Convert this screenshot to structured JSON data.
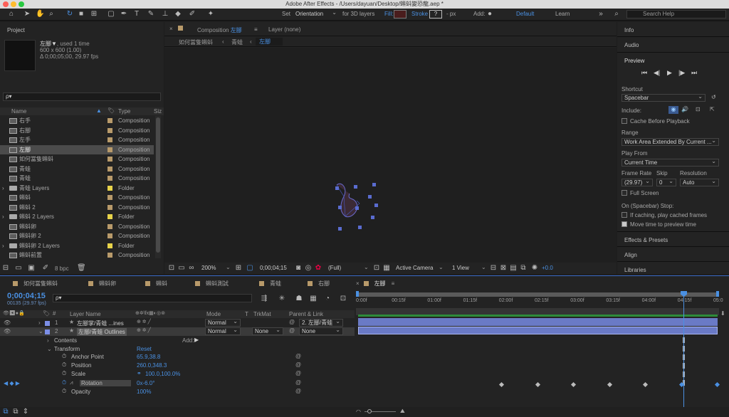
{
  "window": {
    "title": "Adobe After Effects - /Users/dayuan/Desktop/蝌蚪變恐龍.aep *"
  },
  "toolbar": {
    "set_label": "Set",
    "orientation_value": "Orientation",
    "for3d_label": "for 3D layers",
    "fill_label": "Fill:",
    "stroke_label": "Stroke",
    "stroke_value": "?",
    "px_label": "- px",
    "add_label": "Add:",
    "workspace_default": "Default",
    "workspace_learn": "Learn",
    "search_placeholder": "Search Help",
    "fill_color": "#4a1d1d"
  },
  "project": {
    "title": "Project",
    "item_name": "左腳▼",
    "item_used": ", used 1 time",
    "item_size": "600 x 600 (1.00)",
    "item_duration": "Δ 0;00;05;00, 29.97 fps",
    "search_placeholder": "ρ▾",
    "col_name": "Name",
    "col_type": "Type",
    "col_size": "Siz",
    "bpc": "8 bpc",
    "items": [
      {
        "name": "右手",
        "type": "Composition",
        "color": "#b89a6a",
        "kind": "comp"
      },
      {
        "name": "右腳",
        "type": "Composition",
        "color": "#b89a6a",
        "kind": "comp"
      },
      {
        "name": "左手",
        "type": "Composition",
        "color": "#b89a6a",
        "kind": "comp"
      },
      {
        "name": "左腳",
        "type": "Composition",
        "color": "#b89a6a",
        "kind": "comp",
        "selected": true
      },
      {
        "name": "如何當隻蝌蚪",
        "type": "Composition",
        "color": "#b89a6a",
        "kind": "comp"
      },
      {
        "name": "青蛙",
        "type": "Composition",
        "color": "#b89a6a",
        "kind": "comp"
      },
      {
        "name": "青蛙",
        "type": "Composition",
        "color": "#b89a6a",
        "kind": "comp"
      },
      {
        "name": "青蛙 Layers",
        "type": "Folder",
        "color": "#e8d34a",
        "kind": "folder"
      },
      {
        "name": "蝌蚪",
        "type": "Composition",
        "color": "#b89a6a",
        "kind": "comp"
      },
      {
        "name": "蝌蚪 2",
        "type": "Composition",
        "color": "#b89a6a",
        "kind": "comp"
      },
      {
        "name": "蝌蚪 2 Layers",
        "type": "Folder",
        "color": "#e8d34a",
        "kind": "folder"
      },
      {
        "name": "蝌蚪卵",
        "type": "Composition",
        "color": "#b89a6a",
        "kind": "comp"
      },
      {
        "name": "蝌蚪卵 2",
        "type": "Composition",
        "color": "#b89a6a",
        "kind": "comp"
      },
      {
        "name": "蝌蚪卵 2 Layers",
        "type": "Folder",
        "color": "#e8d34a",
        "kind": "folder"
      },
      {
        "name": "蝌蚪前置",
        "type": "Composition",
        "color": "#b89a6a",
        "kind": "comp"
      }
    ]
  },
  "comp": {
    "tab_prefix": "Composition",
    "tab_name": "左腳",
    "layer_tab": "Layer (none)",
    "crumbs": [
      "如何當隻蝌蚪",
      "青蛙",
      "左腳"
    ],
    "zoom": "200%",
    "timecode": "0;00;04;15",
    "resolution": "(Full)",
    "camera": "Active Camera",
    "views": "1 View",
    "exposure": "+0.0"
  },
  "right": {
    "info": "Info",
    "audio": "Audio",
    "preview": "Preview",
    "shortcut_label": "Shortcut",
    "shortcut_value": "Spacebar",
    "include_label": "Include:",
    "cache_label": "Cache Before Playback",
    "range_label": "Range",
    "range_value": "Work Area Extended By Current ...",
    "playfrom_label": "Play From",
    "playfrom_value": "Current Time",
    "framerate_label": "Frame Rate",
    "skip_label": "Skip",
    "resolution_label": "Resolution",
    "framerate_value": "(29.97)",
    "skip_value": "0",
    "resolution_value": "Auto",
    "fullscreen_label": "Full Screen",
    "stop_label": "On (Spacebar) Stop:",
    "ifcaching_label": "If caching, play cached frames",
    "movetime_label": "Move time to preview time",
    "effects": "Effects & Presets",
    "align": "Align",
    "libraries": "Libraries"
  },
  "timeline": {
    "tabs": [
      "如何當隻蝌蚪",
      "蝌蚪卵",
      "蝌蚪",
      "蝌蚪測試",
      "青蛙",
      "右腳",
      "左腳"
    ],
    "timecode": "0;00;04;15",
    "fps_sub": "00135 (29.97 fps)",
    "search_placeholder": "ρ▾",
    "col_layername": "Layer Name",
    "col_mode": "Mode",
    "col_t": "T",
    "col_trkmat": "TrkMat",
    "col_parent": "Parent & Link",
    "ticks": [
      "0:00f",
      "00:15f",
      "01:00f",
      "01:15f",
      "02:00f",
      "02:15f",
      "03:00f",
      "03:15f",
      "04:00f",
      "04:15f",
      "05:0"
    ],
    "layers": [
      {
        "num": "1",
        "name": "左腳掌/青蛙 ...ines",
        "mode": "Normal",
        "trkmat": "",
        "parent": "2. 左腳/青蛙",
        "color": "#7b8ee6"
      },
      {
        "num": "2",
        "name": "左腳/青蛙 Outlines",
        "mode": "Normal",
        "trkmat": "None",
        "parent": "None",
        "color": "#7b8ee6"
      }
    ],
    "contents": "Contents",
    "add": "Add:",
    "transform": "Transform",
    "reset": "Reset",
    "props": [
      {
        "name": "Anchor Point",
        "value": "65.9,38.8"
      },
      {
        "name": "Position",
        "value": "260.0,348.3"
      },
      {
        "name": "Scale",
        "value": "100.0,100.0%"
      },
      {
        "name": "Rotation",
        "value": "0x-6.0°"
      },
      {
        "name": "Opacity",
        "value": "100%"
      }
    ],
    "playhead_fraction": 0.905
  }
}
